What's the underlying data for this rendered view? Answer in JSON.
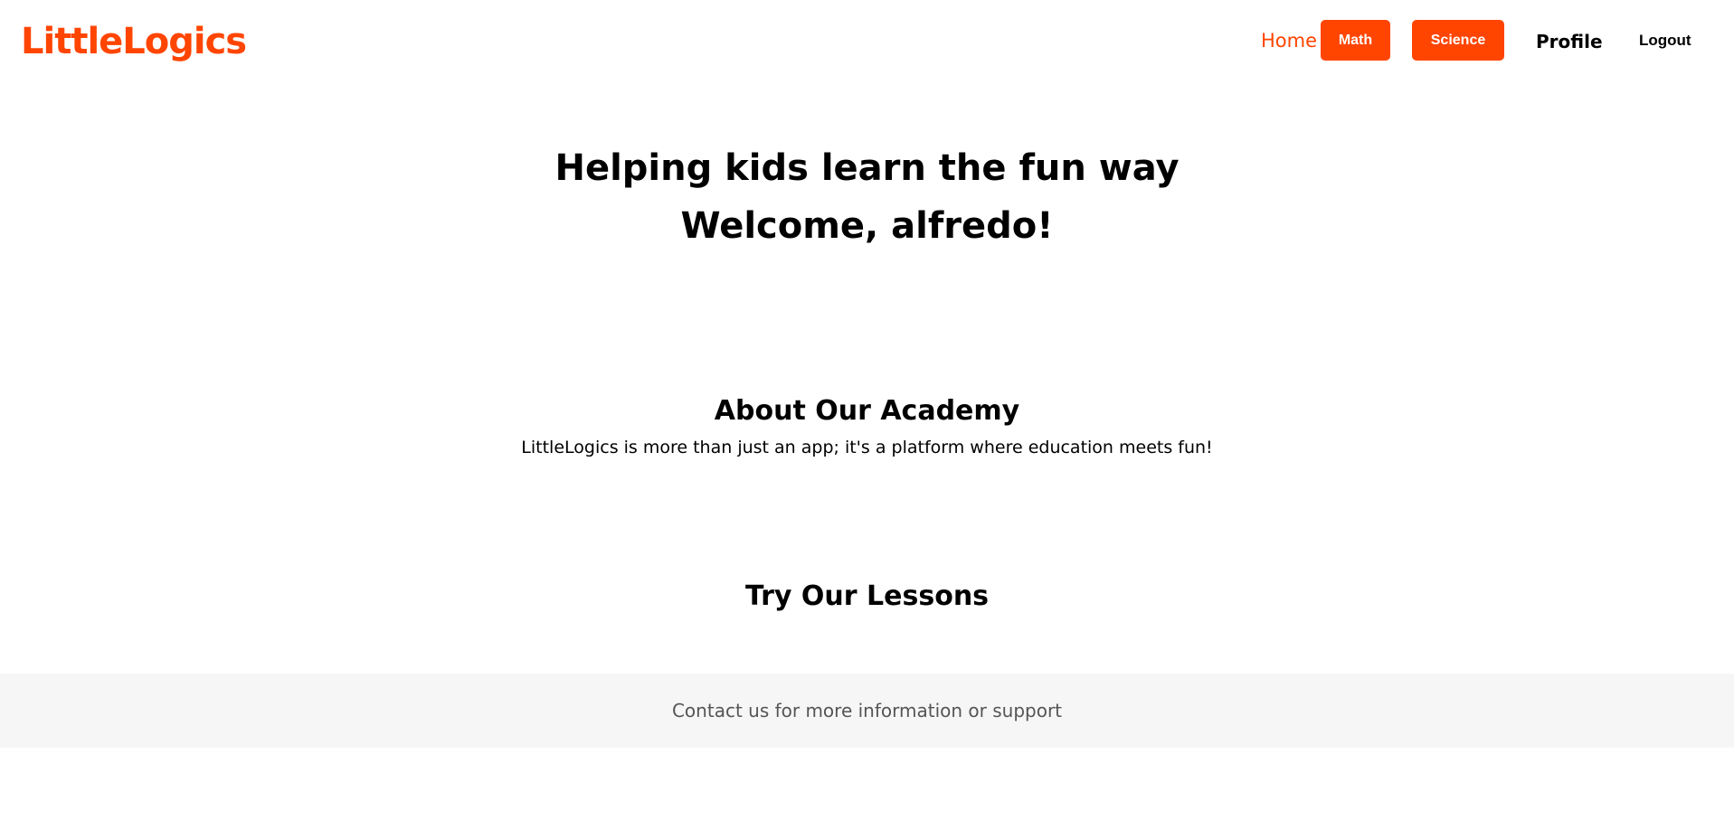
{
  "header": {
    "logo": "LittleLogics",
    "nav": {
      "home": "Home",
      "math": "Math",
      "science": "Science",
      "profile": "Profile",
      "logout": "Logout"
    }
  },
  "hero": {
    "title": "Helping kids learn the fun way",
    "welcome": "Welcome, alfredo!"
  },
  "about": {
    "heading": "About Our Academy",
    "text": "LittleLogics is more than just an app; it's a platform where education meets fun!"
  },
  "lessons": {
    "heading": "Try Our Lessons"
  },
  "footer": {
    "text": "Contact us for more information or support"
  },
  "colors": {
    "brand": "#ff4500",
    "footer_bg": "#f6f6f6",
    "footer_text": "#555555"
  }
}
